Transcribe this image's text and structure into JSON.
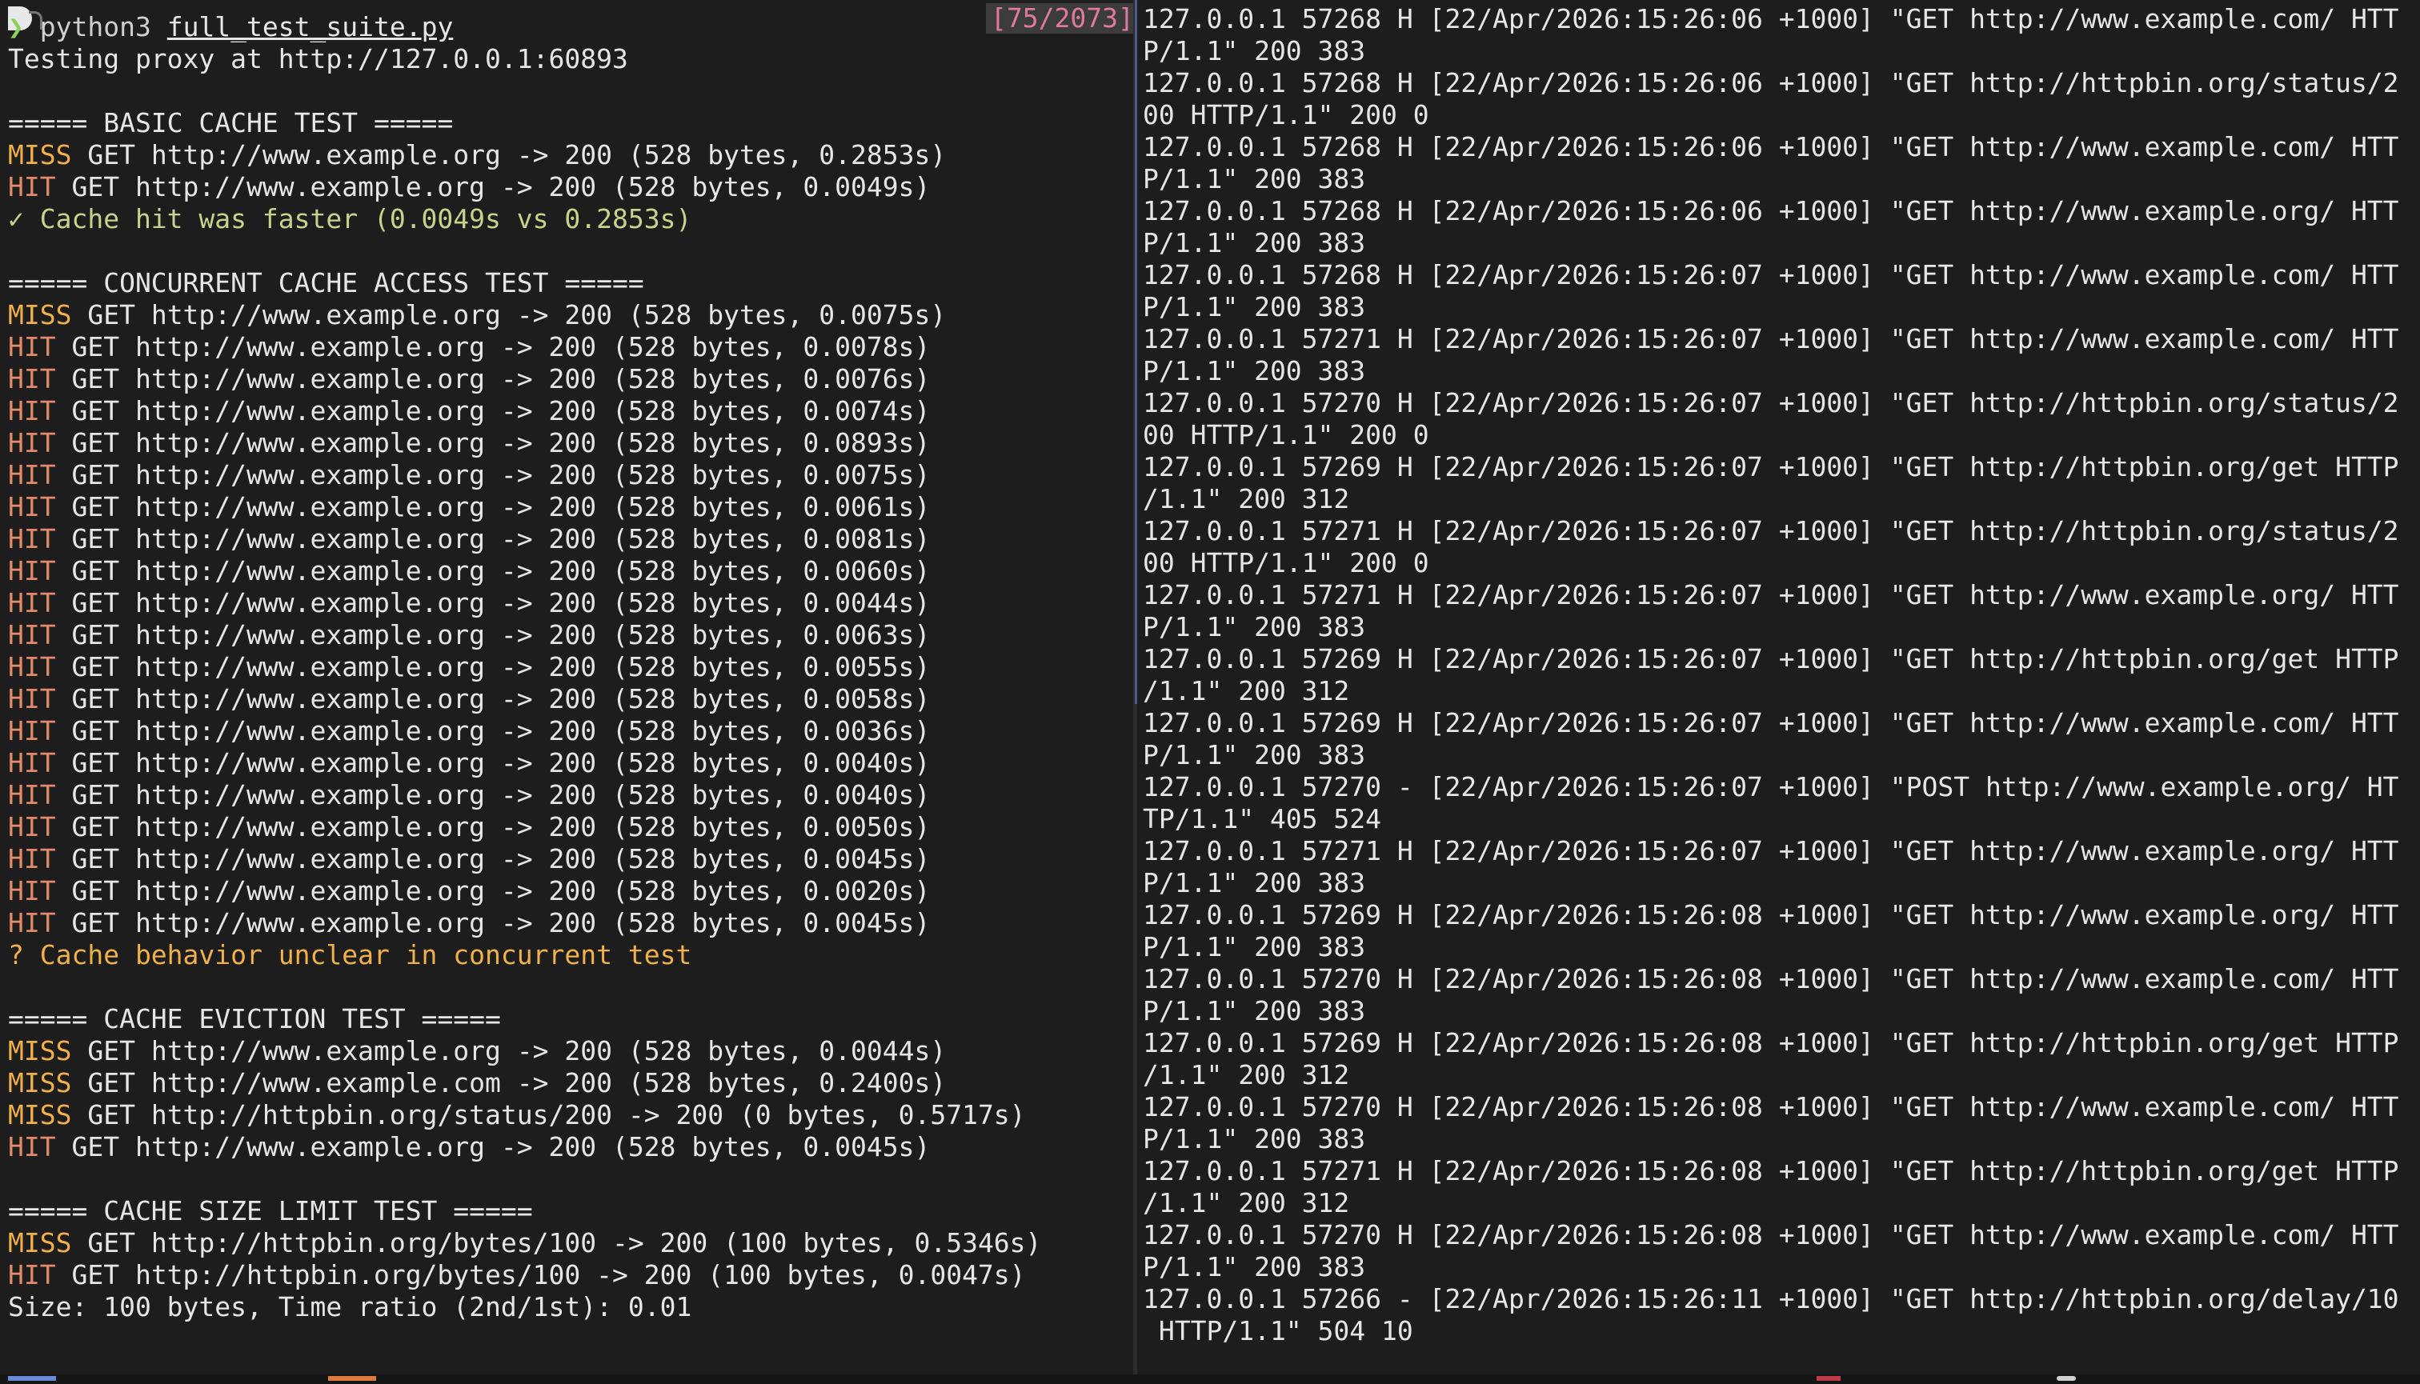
{
  "prompt": {
    "symbol": "❯",
    "command": "python3",
    "argument": "full_test_suite.py"
  },
  "scroll_position": "[75/2073]",
  "left_lines": [
    {
      "text": "Testing proxy at http://127.0.0.1:60893"
    },
    {
      "text": ""
    },
    {
      "text": "===== BASIC CACHE TEST ====="
    },
    {
      "tag": "MISS",
      "text": " GET http://www.example.org -> 200 (528 bytes, 0.2853s)"
    },
    {
      "tag": "HIT",
      "text": " GET http://www.example.org -> 200 (528 bytes, 0.0049s)"
    },
    {
      "kind": "check",
      "text": "✓ Cache hit was faster (0.0049s vs 0.2853s)"
    },
    {
      "text": ""
    },
    {
      "text": "===== CONCURRENT CACHE ACCESS TEST ====="
    },
    {
      "tag": "MISS",
      "text": " GET http://www.example.org -> 200 (528 bytes, 0.0075s)"
    },
    {
      "tag": "HIT",
      "text": " GET http://www.example.org -> 200 (528 bytes, 0.0078s)"
    },
    {
      "tag": "HIT",
      "text": " GET http://www.example.org -> 200 (528 bytes, 0.0076s)"
    },
    {
      "tag": "HIT",
      "text": " GET http://www.example.org -> 200 (528 bytes, 0.0074s)"
    },
    {
      "tag": "HIT",
      "text": " GET http://www.example.org -> 200 (528 bytes, 0.0893s)"
    },
    {
      "tag": "HIT",
      "text": " GET http://www.example.org -> 200 (528 bytes, 0.0075s)"
    },
    {
      "tag": "HIT",
      "text": " GET http://www.example.org -> 200 (528 bytes, 0.0061s)"
    },
    {
      "tag": "HIT",
      "text": " GET http://www.example.org -> 200 (528 bytes, 0.0081s)"
    },
    {
      "tag": "HIT",
      "text": " GET http://www.example.org -> 200 (528 bytes, 0.0060s)"
    },
    {
      "tag": "HIT",
      "text": " GET http://www.example.org -> 200 (528 bytes, 0.0044s)"
    },
    {
      "tag": "HIT",
      "text": " GET http://www.example.org -> 200 (528 bytes, 0.0063s)"
    },
    {
      "tag": "HIT",
      "text": " GET http://www.example.org -> 200 (528 bytes, 0.0055s)"
    },
    {
      "tag": "HIT",
      "text": " GET http://www.example.org -> 200 (528 bytes, 0.0058s)"
    },
    {
      "tag": "HIT",
      "text": " GET http://www.example.org -> 200 (528 bytes, 0.0036s)"
    },
    {
      "tag": "HIT",
      "text": " GET http://www.example.org -> 200 (528 bytes, 0.0040s)"
    },
    {
      "tag": "HIT",
      "text": " GET http://www.example.org -> 200 (528 bytes, 0.0040s)"
    },
    {
      "tag": "HIT",
      "text": " GET http://www.example.org -> 200 (528 bytes, 0.0050s)"
    },
    {
      "tag": "HIT",
      "text": " GET http://www.example.org -> 200 (528 bytes, 0.0045s)"
    },
    {
      "tag": "HIT",
      "text": " GET http://www.example.org -> 200 (528 bytes, 0.0020s)"
    },
    {
      "tag": "HIT",
      "text": " GET http://www.example.org -> 200 (528 bytes, 0.0045s)"
    },
    {
      "kind": "warn",
      "text": "? Cache behavior unclear in concurrent test"
    },
    {
      "text": ""
    },
    {
      "text": "===== CACHE EVICTION TEST ====="
    },
    {
      "tag": "MISS",
      "text": " GET http://www.example.org -> 200 (528 bytes, 0.0044s)"
    },
    {
      "tag": "MISS",
      "text": " GET http://www.example.com -> 200 (528 bytes, 0.2400s)"
    },
    {
      "tag": "MISS",
      "text": " GET http://httpbin.org/status/200 -> 200 (0 bytes, 0.5717s)"
    },
    {
      "tag": "HIT",
      "text": " GET http://www.example.org -> 200 (528 bytes, 0.0045s)"
    },
    {
      "text": ""
    },
    {
      "text": "===== CACHE SIZE LIMIT TEST ====="
    },
    {
      "tag": "MISS",
      "text": " GET http://httpbin.org/bytes/100 -> 200 (100 bytes, 0.5346s)"
    },
    {
      "tag": "HIT",
      "text": " GET http://httpbin.org/bytes/100 -> 200 (100 bytes, 0.0047s)"
    },
    {
      "text": "Size: 100 bytes, Time ratio (2nd/1st): 0.01"
    }
  ],
  "log_entries": [
    {
      "l1": "127.0.0.1 57268 H [22/Apr/2026:15:26:06 +1000] \"GET http://www.example.com/ HTT",
      "l2": "P/1.1\" 200 383"
    },
    {
      "l1": "127.0.0.1 57268 H [22/Apr/2026:15:26:06 +1000] \"GET http://httpbin.org/status/2",
      "l2": "00 HTTP/1.1\" 200 0"
    },
    {
      "l1": "127.0.0.1 57268 H [22/Apr/2026:15:26:06 +1000] \"GET http://www.example.com/ HTT",
      "l2": "P/1.1\" 200 383"
    },
    {
      "l1": "127.0.0.1 57268 H [22/Apr/2026:15:26:06 +1000] \"GET http://www.example.org/ HTT",
      "l2": "P/1.1\" 200 383"
    },
    {
      "l1": "127.0.0.1 57268 H [22/Apr/2026:15:26:07 +1000] \"GET http://www.example.com/ HTT",
      "l2": "P/1.1\" 200 383"
    },
    {
      "l1": "127.0.0.1 57271 H [22/Apr/2026:15:26:07 +1000] \"GET http://www.example.com/ HTT",
      "l2": "P/1.1\" 200 383"
    },
    {
      "l1": "127.0.0.1 57270 H [22/Apr/2026:15:26:07 +1000] \"GET http://httpbin.org/status/2",
      "l2": "00 HTTP/1.1\" 200 0"
    },
    {
      "l1": "127.0.0.1 57269 H [22/Apr/2026:15:26:07 +1000] \"GET http://httpbin.org/get HTTP",
      "l2": "/1.1\" 200 312"
    },
    {
      "l1": "127.0.0.1 57271 H [22/Apr/2026:15:26:07 +1000] \"GET http://httpbin.org/status/2",
      "l2": "00 HTTP/1.1\" 200 0"
    },
    {
      "l1": "127.0.0.1 57271 H [22/Apr/2026:15:26:07 +1000] \"GET http://www.example.org/ HTT",
      "l2": "P/1.1\" 200 383"
    },
    {
      "l1": "127.0.0.1 57269 H [22/Apr/2026:15:26:07 +1000] \"GET http://httpbin.org/get HTTP",
      "l2": "/1.1\" 200 312"
    },
    {
      "l1": "127.0.0.1 57269 H [22/Apr/2026:15:26:07 +1000] \"GET http://www.example.com/ HTT",
      "l2": "P/1.1\" 200 383"
    },
    {
      "l1": "127.0.0.1 57270 - [22/Apr/2026:15:26:07 +1000] \"POST http://www.example.org/ HT",
      "l2": "TP/1.1\" 405 524"
    },
    {
      "l1": "127.0.0.1 57271 H [22/Apr/2026:15:26:07 +1000] \"GET http://www.example.org/ HTT",
      "l2": "P/1.1\" 200 383"
    },
    {
      "l1": "127.0.0.1 57269 H [22/Apr/2026:15:26:08 +1000] \"GET http://www.example.org/ HTT",
      "l2": "P/1.1\" 200 383"
    },
    {
      "l1": "127.0.0.1 57270 H [22/Apr/2026:15:26:08 +1000] \"GET http://www.example.com/ HTT",
      "l2": "P/1.1\" 200 383"
    },
    {
      "l1": "127.0.0.1 57269 H [22/Apr/2026:15:26:08 +1000] \"GET http://httpbin.org/get HTTP",
      "l2": "/1.1\" 200 312"
    },
    {
      "l1": "127.0.0.1 57270 H [22/Apr/2026:15:26:08 +1000] \"GET http://www.example.com/ HTT",
      "l2": "P/1.1\" 200 383"
    },
    {
      "l1": "127.0.0.1 57271 H [22/Apr/2026:15:26:08 +1000] \"GET http://httpbin.org/get HTTP",
      "l2": "/1.1\" 200 312"
    },
    {
      "l1": "127.0.0.1 57270 H [22/Apr/2026:15:26:08 +1000] \"GET http://www.example.com/ HTT",
      "l2": "P/1.1\" 200 383"
    },
    {
      "l1": "127.0.0.1 57266 - [22/Apr/2026:15:26:11 +1000] \"GET http://httpbin.org/delay/10",
      "l2": " HTTP/1.1\" 504 10"
    }
  ],
  "colors": {
    "background": "#1d1d1d",
    "foreground": "#e6e6e6",
    "miss": "#f0b04a",
    "hit": "#e08a6a",
    "check": "#c7d38b",
    "prompt": "#8bd05a",
    "scroll_badge": "#e07a9a"
  }
}
